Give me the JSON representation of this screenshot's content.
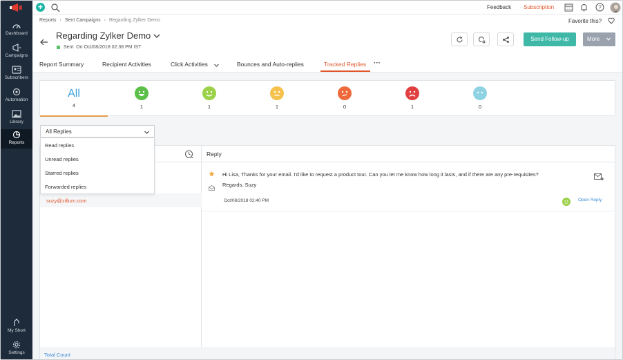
{
  "sidebar": {
    "items": [
      {
        "label": "Dashboard",
        "icon": "dashboard-icon"
      },
      {
        "label": "Campaigns",
        "icon": "megaphone-icon"
      },
      {
        "label": "Subscribers",
        "icon": "contacts-icon"
      },
      {
        "label": "Automation",
        "icon": "automation-icon"
      },
      {
        "label": "Library",
        "icon": "image-icon"
      },
      {
        "label": "Reports",
        "icon": "pie-chart-icon",
        "active": true
      }
    ],
    "bottom_items": [
      {
        "label": "My Short",
        "icon": "shortcut-icon"
      },
      {
        "label": "Settings",
        "icon": "gear-icon"
      }
    ]
  },
  "topbar": {
    "feedback": "Feedback",
    "subscription": "Subscription"
  },
  "breadcrumb": {
    "items": [
      "Reports",
      "Sent Campaigns",
      "Regarding Zylker Demo"
    ],
    "separator": "›"
  },
  "header": {
    "title": "Regarding Zylker Demo",
    "status": "Sent",
    "status_detail": "On Oct/08/2018 02:38 PM IST",
    "favorite": "Favorite this?",
    "follow_up": "Send Follow-up",
    "more": "More"
  },
  "tabs": [
    {
      "label": "Report Summary"
    },
    {
      "label": "Recipient Activities"
    },
    {
      "label": "Click Activities"
    },
    {
      "label": "Bounces and Auto-replies"
    },
    {
      "label": "Tracked Replies",
      "active": true
    }
  ],
  "ratings": {
    "all_label": "All",
    "all_count": "4",
    "faces": [
      {
        "name": "very-happy",
        "count": "1",
        "color": "#5cbf4a"
      },
      {
        "name": "happy",
        "count": "1",
        "color": "#9cd14a"
      },
      {
        "name": "neutral",
        "count": "1",
        "color": "#f5c24e"
      },
      {
        "name": "unhappy",
        "count": "0",
        "color": "#ee6a3c"
      },
      {
        "name": "angry",
        "count": "1",
        "color": "#e04040"
      },
      {
        "name": "no-rating",
        "count": "0",
        "color": "#8fd3e3"
      }
    ]
  },
  "filter": {
    "selected": "All Replies",
    "options": [
      "Read replies",
      "Unread replies",
      "Starred replies",
      "Forwarded replies"
    ]
  },
  "list": {
    "selected_email": "suzy@zillum.com",
    "total_label": "Total Count"
  },
  "reply": {
    "header": "Reply",
    "text": "Hi Lisa, Thanks for your email. I'd like to request a product tour. Can you let me know how long it lasts, and if there are any pre-requisites?",
    "signature": "Regards, Suzy",
    "date": "Oct/08/2018 02:40 PM",
    "open_reply": "Open Reply"
  },
  "colors": {
    "accent_orange": "#e0572d",
    "teal": "#3fb8a8",
    "link_blue": "#3d8bd6",
    "sidebar_bg": "#1d2b3a"
  }
}
